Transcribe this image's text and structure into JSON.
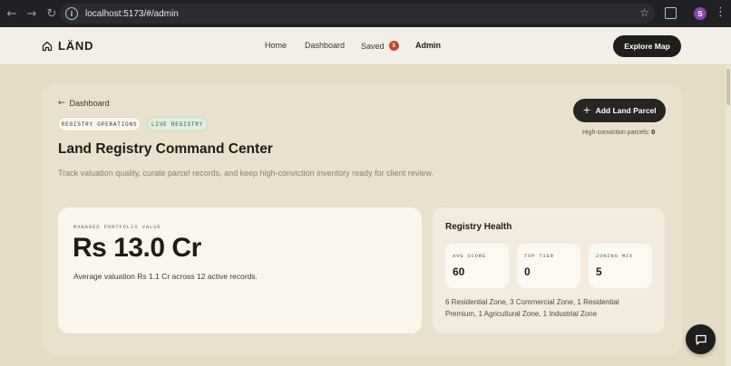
{
  "browser": {
    "url": "localhost:5173/#/admin",
    "profile_initial": "S",
    "icons": [
      "back-icon",
      "forward-icon",
      "reload-icon",
      "site-info-icon",
      "bookmark-star-icon",
      "extensions-icon",
      "menu-kebab-icon"
    ]
  },
  "header": {
    "brand": "LÄND",
    "nav": {
      "home": "Home",
      "dashboard": "Dashboard",
      "saved": "Saved",
      "saved_count": "3",
      "admin": "Admin"
    },
    "explore_label": "Explore Map"
  },
  "page": {
    "back_label": "Dashboard",
    "tags": [
      "REGISTRY OPERATIONS",
      "LIVE REGISTRY"
    ],
    "title": "Land Registry Command Center",
    "description": "Track valuation quality, curate parcel records, and keep high-conviction inventory ready for client review.",
    "add_label": "Add Land Parcel",
    "conviction_label": "High-conviction parcels:",
    "conviction_value": "0"
  },
  "portfolio": {
    "label": "MANAGED PORTFOLIO VALUE",
    "value": "Rs 13.0 Cr",
    "subtitle": "Average valuation Rs 1.1 Cr across 12 active records."
  },
  "health": {
    "title": "Registry Health",
    "stats": [
      {
        "label": "AVG SCORE",
        "value": "60"
      },
      {
        "label": "TOP TIER",
        "value": "0"
      },
      {
        "label": "ZONING MIX",
        "value": "5"
      }
    ],
    "zoning_text": "6 Residential Zone, 3 Commercial Zone, 1 Residential Premium, 1 Agricultural Zone, 1 Industrial Zone"
  },
  "colors": {
    "accent_dark": "#1f1e1c",
    "badge": "#c2492c",
    "live_tag": "#dfeee0",
    "background": "#e6dcc6"
  }
}
